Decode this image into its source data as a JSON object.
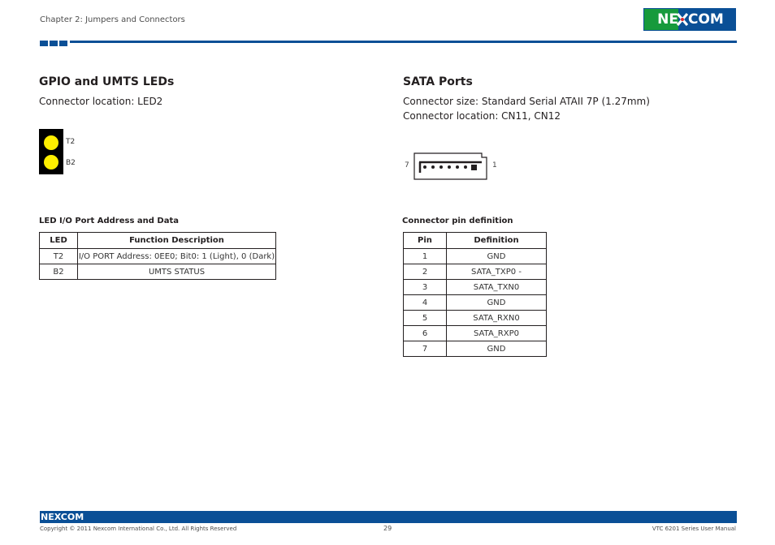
{
  "header": {
    "chapter": "Chapter 2: Jumpers and Connectors",
    "logo_text_left": "NE",
    "logo_text_right": "COM",
    "brand_color": "#0a4f96",
    "brand_green": "#179a3c"
  },
  "gpio": {
    "title": "GPIO and UMTS LEDs",
    "location": "Connector location: LED2",
    "leds": [
      {
        "label": "T2",
        "color": "#ffef00"
      },
      {
        "label": "B2",
        "color": "#ffef00"
      }
    ],
    "table_caption": "LED I/O Port Address and Data",
    "table": {
      "headers": [
        "LED",
        "Function Description"
      ],
      "rows": [
        [
          "T2",
          "I/O PORT Address: 0EE0; Bit0: 1 (Light), 0 (Dark)"
        ],
        [
          "B2",
          "UMTS STATUS"
        ]
      ]
    }
  },
  "sata": {
    "title": "SATA Ports",
    "size": "Connector size: Standard Serial ATAII 7P (1.27mm)",
    "location": "Connector location: CN11, CN12",
    "pin_left": "7",
    "pin_right": "1",
    "pin_count": 7,
    "table_caption": "Connector pin definition",
    "table": {
      "headers": [
        "Pin",
        "Definition"
      ],
      "rows": [
        [
          "1",
          "GND"
        ],
        [
          "2",
          "SATA_TXP0 -"
        ],
        [
          "3",
          "SATA_TXN0"
        ],
        [
          "4",
          "GND"
        ],
        [
          "5",
          "SATA_RXN0"
        ],
        [
          "6",
          "SATA_RXP0"
        ],
        [
          "7",
          "GND"
        ]
      ]
    }
  },
  "footer": {
    "logo_text": "NEXCOM",
    "copyright": "Copyright © 2011 Nexcom International Co., Ltd. All Rights Reserved",
    "page_number": "29",
    "manual_title": "VTC 6201 Series User Manual"
  }
}
